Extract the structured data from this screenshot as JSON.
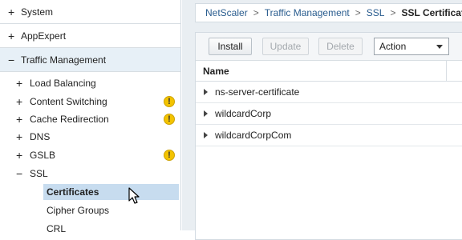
{
  "nav": {
    "top": [
      {
        "symbol": "+",
        "label": "System"
      },
      {
        "symbol": "+",
        "label": "AppExpert"
      },
      {
        "symbol": "−",
        "label": "Traffic Management"
      }
    ],
    "sub": [
      {
        "symbol": "+",
        "label": "Load Balancing",
        "warning": ""
      },
      {
        "symbol": "+",
        "label": "Content Switching",
        "warning": "!"
      },
      {
        "symbol": "+",
        "label": "Cache Redirection",
        "warning": "!"
      },
      {
        "symbol": "+",
        "label": "DNS",
        "warning": ""
      },
      {
        "symbol": "+",
        "label": "GSLB",
        "warning": "!"
      },
      {
        "symbol": "−",
        "label": "SSL",
        "warning": ""
      }
    ],
    "leaves": [
      {
        "label": "Certificates",
        "selected": true
      },
      {
        "label": "Cipher Groups",
        "selected": false
      },
      {
        "label": "CRL",
        "selected": false
      }
    ]
  },
  "breadcrumb": {
    "items": [
      "NetScaler",
      "Traffic Management",
      "SSL"
    ],
    "separator": ">",
    "current": "SSL Certificates"
  },
  "toolbar": {
    "install": "Install",
    "update": "Update",
    "delete": "Delete",
    "action": "Action"
  },
  "grid": {
    "column": "Name",
    "rows": [
      "ns-server-certificate",
      "wildcardCorp",
      "wildcardCorpCom"
    ]
  },
  "colors": {
    "selected_bg": "#c7dcef",
    "expanded_bg": "#e7f0f7",
    "warning": "#f3c300",
    "link": "#2a5d8f"
  }
}
